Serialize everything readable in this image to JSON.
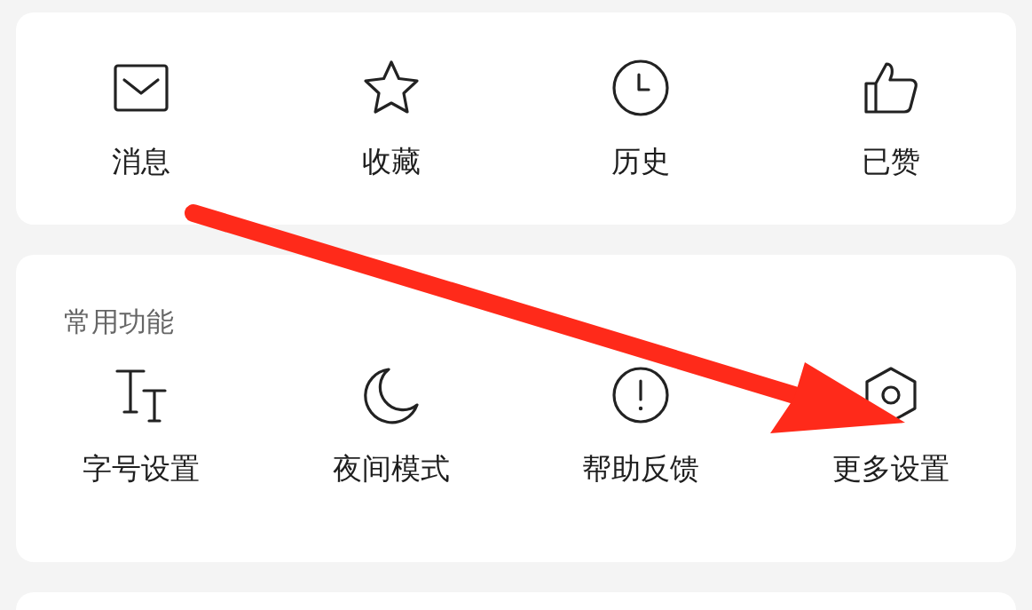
{
  "shortcuts": [
    {
      "label": "消息"
    },
    {
      "label": "收藏"
    },
    {
      "label": "历史"
    },
    {
      "label": "已赞"
    }
  ],
  "common_functions": {
    "title": "常用功能",
    "items": [
      {
        "label": "字号设置"
      },
      {
        "label": "夜间模式"
      },
      {
        "label": "帮助反馈"
      },
      {
        "label": "更多设置"
      }
    ]
  }
}
